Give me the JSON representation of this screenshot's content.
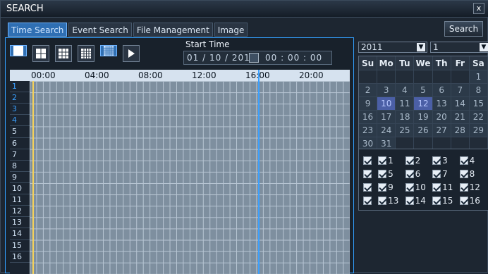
{
  "window": {
    "title": "SEARCH",
    "close_symbol": "x"
  },
  "tabs": [
    {
      "label": "Time Search",
      "active": true
    },
    {
      "label": "Event Search",
      "active": false
    },
    {
      "label": "File Management",
      "active": false
    },
    {
      "label": "Image",
      "active": false
    }
  ],
  "search_button": {
    "label": "Search"
  },
  "toolbar": {
    "layout_icons": [
      "layout-1x1-icon",
      "layout-2x2-icon",
      "layout-3x3-icon",
      "layout-4x4-icon",
      "layout-5x5-icon"
    ],
    "play_icon": "play-icon"
  },
  "start_time": {
    "label": "Start Time",
    "date": "01 / 10 / 2011",
    "time": "00  :  00  :  00"
  },
  "timeline": {
    "ticks": [
      "00:00",
      "04:00",
      "08:00",
      "12:00",
      "16:00",
      "20:00"
    ],
    "rows": [
      "1",
      "2",
      "3",
      "4",
      "5",
      "6",
      "7",
      "8",
      "9",
      "10",
      "11",
      "12",
      "13",
      "14",
      "15",
      "16"
    ],
    "highlight_rows": [
      "1",
      "2",
      "3",
      "4"
    ]
  },
  "calendar": {
    "year": "2011",
    "month": "1",
    "weekdays": [
      "Su",
      "Mo",
      "Tu",
      "We",
      "Th",
      "Fr",
      "Sa"
    ],
    "weeks": [
      [
        "",
        "",
        "",
        "",
        "",
        "",
        "1"
      ],
      [
        "2",
        "3",
        "4",
        "5",
        "6",
        "7",
        "8"
      ],
      [
        "9",
        "10",
        "11",
        "12",
        "13",
        "14",
        "15"
      ],
      [
        "16",
        "17",
        "18",
        "19",
        "20",
        "21",
        "22"
      ],
      [
        "23",
        "24",
        "25",
        "26",
        "27",
        "28",
        "29"
      ],
      [
        "30",
        "31",
        "",
        "",
        "",
        "",
        ""
      ]
    ],
    "recorded_days": [
      "10",
      "12"
    ]
  },
  "channels": {
    "rows": [
      [
        "1",
        "2",
        "3",
        "4"
      ],
      [
        "5",
        "6",
        "7",
        "8"
      ],
      [
        "9",
        "10",
        "11",
        "12"
      ],
      [
        "13",
        "14",
        "15",
        "16"
      ]
    ]
  }
}
